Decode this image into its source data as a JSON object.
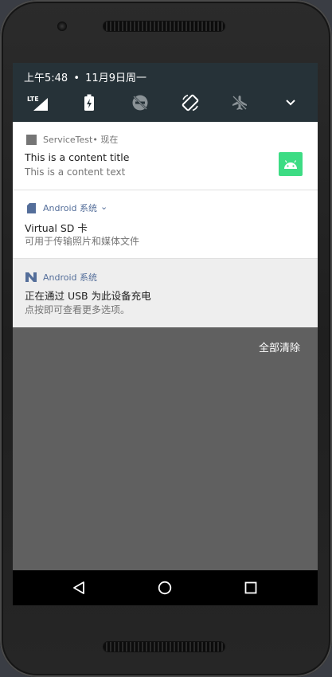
{
  "status_bar": {
    "time": "上午5:48",
    "separator": "•",
    "date": "11月9日周一",
    "lte_label": "LTE"
  },
  "quick_settings": [
    {
      "icon": "lte-signal-icon"
    },
    {
      "icon": "battery-charging-icon"
    },
    {
      "icon": "do-not-disturb-off-icon"
    },
    {
      "icon": "auto-rotate-icon"
    },
    {
      "icon": "airplane-mode-icon"
    },
    {
      "icon": "expand-chevron-icon"
    }
  ],
  "notifications": [
    {
      "app": "ServiceTest",
      "meta": " • 现在",
      "title": "This is a content title",
      "text": "This is a content text",
      "large_icon": "android-robot-icon",
      "large_icon_color": "#3ddc84"
    },
    {
      "app": "Android 系统",
      "expand": "⌄",
      "title": "Virtual SD 卡",
      "text": "可用于传输照片和媒体文件"
    },
    {
      "app": "Android 系统",
      "title": "正在通过 USB 为此设备充电",
      "text": "点按即可查看更多选项。"
    }
  ],
  "clear_all_label": "全部清除",
  "nav": [
    "back-icon",
    "home-icon",
    "recents-icon"
  ],
  "colors": {
    "status_bar_bg": "#263238",
    "shade_bg": "#606060",
    "android_blue": "#546e9a"
  }
}
